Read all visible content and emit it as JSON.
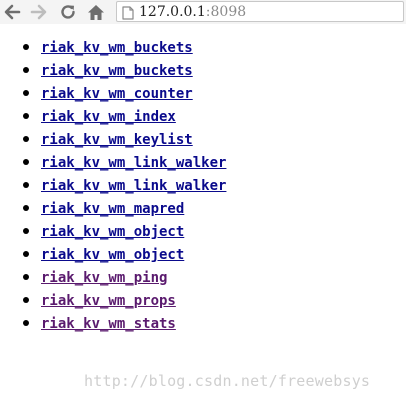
{
  "browser": {
    "url_host": "127.0.0.1",
    "url_port": ":8098",
    "icons": [
      "back-icon",
      "forward-icon",
      "reload-icon",
      "home-icon",
      "page-icon"
    ]
  },
  "resources": {
    "items": [
      {
        "label": "riak_kv_wm_buckets",
        "visited": false
      },
      {
        "label": "riak_kv_wm_buckets",
        "visited": false
      },
      {
        "label": "riak_kv_wm_counter",
        "visited": false
      },
      {
        "label": "riak_kv_wm_index",
        "visited": false
      },
      {
        "label": "riak_kv_wm_keylist",
        "visited": false
      },
      {
        "label": "riak_kv_wm_link_walker",
        "visited": false
      },
      {
        "label": "riak_kv_wm_link_walker",
        "visited": false
      },
      {
        "label": "riak_kv_wm_mapred",
        "visited": false
      },
      {
        "label": "riak_kv_wm_object",
        "visited": false
      },
      {
        "label": "riak_kv_wm_object",
        "visited": false
      },
      {
        "label": "riak_kv_wm_ping",
        "visited": true
      },
      {
        "label": "riak_kv_wm_props",
        "visited": true
      },
      {
        "label": "riak_kv_wm_stats",
        "visited": true
      }
    ]
  },
  "watermark": "http://blog.csdn.net/freewebsys",
  "colors": {
    "link": "#0a0a8c",
    "visited_link": "#5a1a6e",
    "watermark": "#cfcfcf"
  }
}
